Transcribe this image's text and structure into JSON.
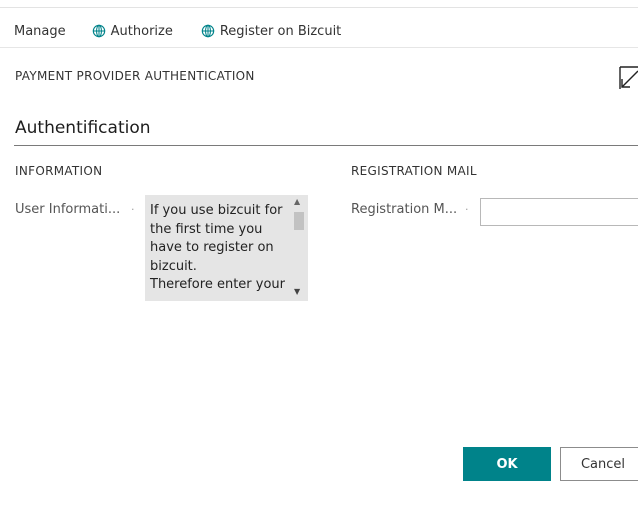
{
  "actions": {
    "manage": "Manage",
    "authorize": "Authorize",
    "register": "Register on Bizcuit"
  },
  "page": {
    "caption": "PAYMENT PROVIDER AUTHENTICATION",
    "section_title": "Authentification"
  },
  "groups": {
    "information": {
      "header": "INFORMATION",
      "field_label": "User Informati...",
      "field_value": "If you use bizcuit for the first time you have to register on bizcuit.\nTherefore enter your"
    },
    "registration_mail": {
      "header": "REGISTRATION MAIL",
      "field_label": "Registration M...",
      "field_value": ""
    }
  },
  "footer": {
    "ok_label": "OK",
    "cancel_label": "Cancel"
  },
  "colors": {
    "primary": "#00838a",
    "textarea_bg": "#e5e5e5"
  }
}
